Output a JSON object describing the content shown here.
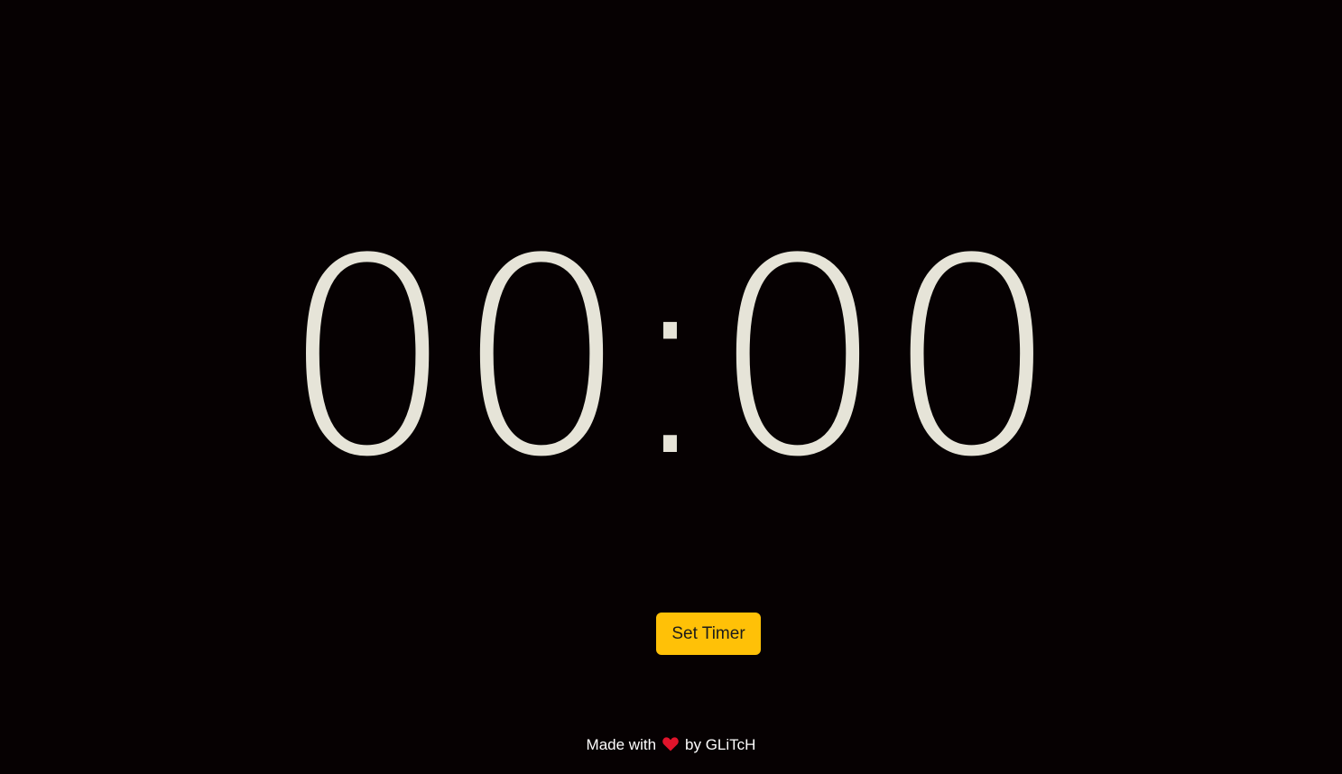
{
  "timer": {
    "minutes": "00",
    "separator": ":",
    "seconds": "00"
  },
  "controls": {
    "set_timer_label": "Set Timer"
  },
  "footer": {
    "prefix": "Made with",
    "icon": "heart-icon",
    "suffix": "by GLiTcH"
  },
  "colors": {
    "background": "#060102",
    "digits": "#e6e4d8",
    "button": "#ffc107",
    "heart": "#e0142b"
  }
}
